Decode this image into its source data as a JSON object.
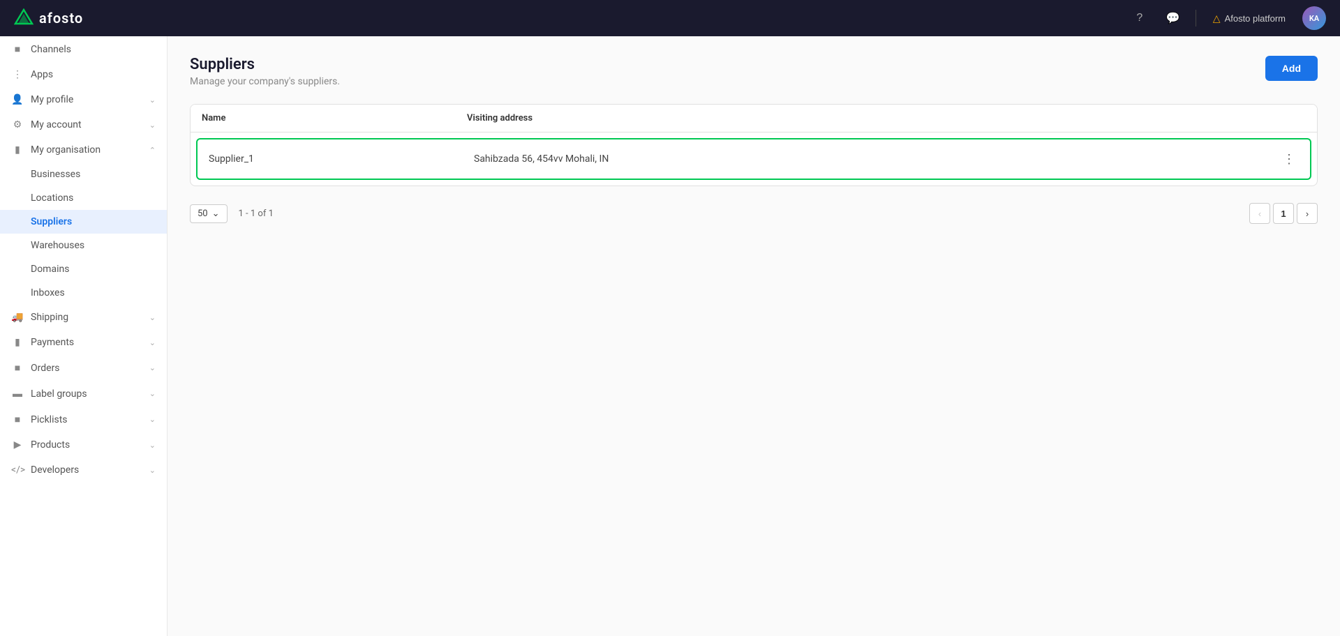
{
  "topnav": {
    "logo_text": "afosto",
    "help_icon": "?",
    "chat_icon": "💬",
    "platform_label": "Afosto platform",
    "platform_icon": "⚠",
    "avatar_text": "KA"
  },
  "sidebar": {
    "channels_label": "Channels",
    "apps_label": "Apps",
    "my_profile_label": "My profile",
    "my_account_label": "My account",
    "my_organisation_label": "My organisation",
    "businesses_label": "Businesses",
    "locations_label": "Locations",
    "suppliers_label": "Suppliers",
    "warehouses_label": "Warehouses",
    "domains_label": "Domains",
    "inboxes_label": "Inboxes",
    "shipping_label": "Shipping",
    "payments_label": "Payments",
    "orders_label": "Orders",
    "label_groups_label": "Label groups",
    "picklists_label": "Picklists",
    "products_label": "Products",
    "developers_label": "Developers"
  },
  "page": {
    "title": "Suppliers",
    "subtitle": "Manage your company's suppliers.",
    "add_button": "Add"
  },
  "table": {
    "col_name": "Name",
    "col_address": "Visiting address",
    "rows": [
      {
        "name": "Supplier_1",
        "address": "Sahibzada 56, 454vv Mohali, IN"
      }
    ]
  },
  "pagination": {
    "per_page": "50",
    "info": "1 - 1 of 1",
    "current_page": "1"
  }
}
